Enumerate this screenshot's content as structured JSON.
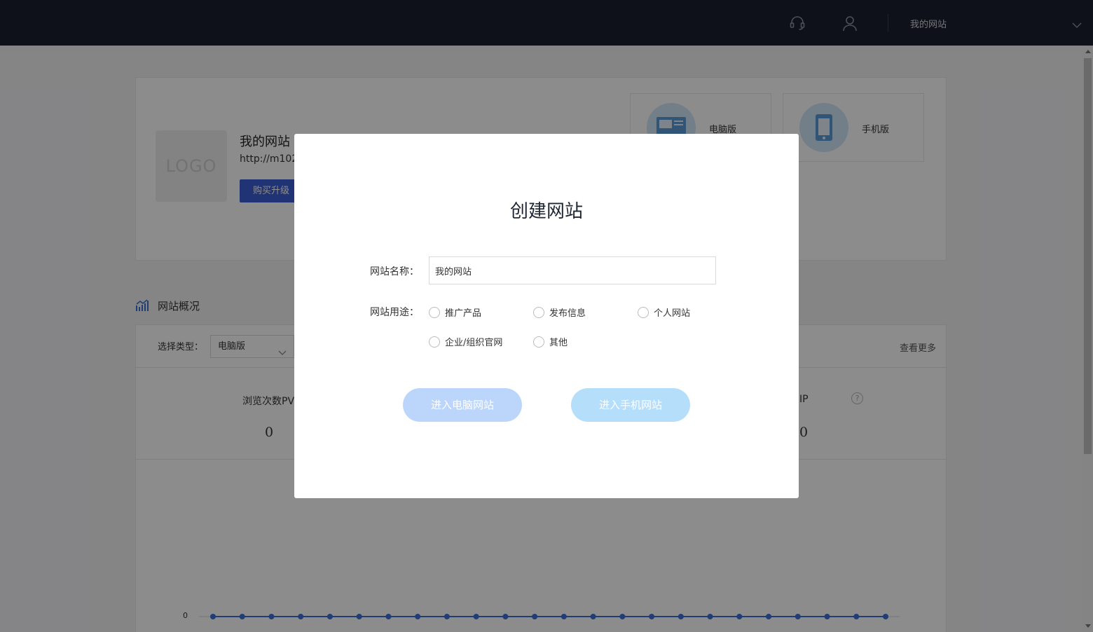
{
  "topbar": {
    "support_icon": "headset-icon",
    "user_icon": "user-icon",
    "site_name": "我的网站",
    "dropdown_icon": "chevron-down-icon"
  },
  "site_card": {
    "logo_text": "LOGO",
    "name": "我的网站",
    "url": "http://m102",
    "upgrade_button": "购买升级",
    "versions": [
      {
        "label": "电脑版",
        "icon": "monitor-icon"
      },
      {
        "label": "手机版",
        "icon": "phone-icon"
      }
    ]
  },
  "overview": {
    "title": "网站概况",
    "icon": "chart-trend-icon",
    "filter_label": "选择类型：",
    "filter_value": "电脑版",
    "view_more": "查看更多",
    "stats": [
      {
        "label": "浏览次数PV",
        "value": "0"
      },
      {
        "label": "IP",
        "value": "0"
      }
    ],
    "chart_axis_zero": "0"
  },
  "modal": {
    "title": "创建网站",
    "name_label": "网站名称：",
    "name_value": "我的网站",
    "purpose_label": "网站用途：",
    "purposes": [
      "推广产品",
      "发布信息",
      "个人网站",
      "企业/组织官网",
      "其他"
    ],
    "enter_pc_button": "进入电脑网站",
    "enter_mobile_button": "进入手机网站"
  },
  "colors": {
    "topbar_bg": "#1b2030",
    "primary": "#3b5fd6",
    "btn_pc_disabled": "#bcd6fb",
    "btn_mobile_disabled": "#b5defb",
    "chart_line": "#3b6fd6"
  }
}
